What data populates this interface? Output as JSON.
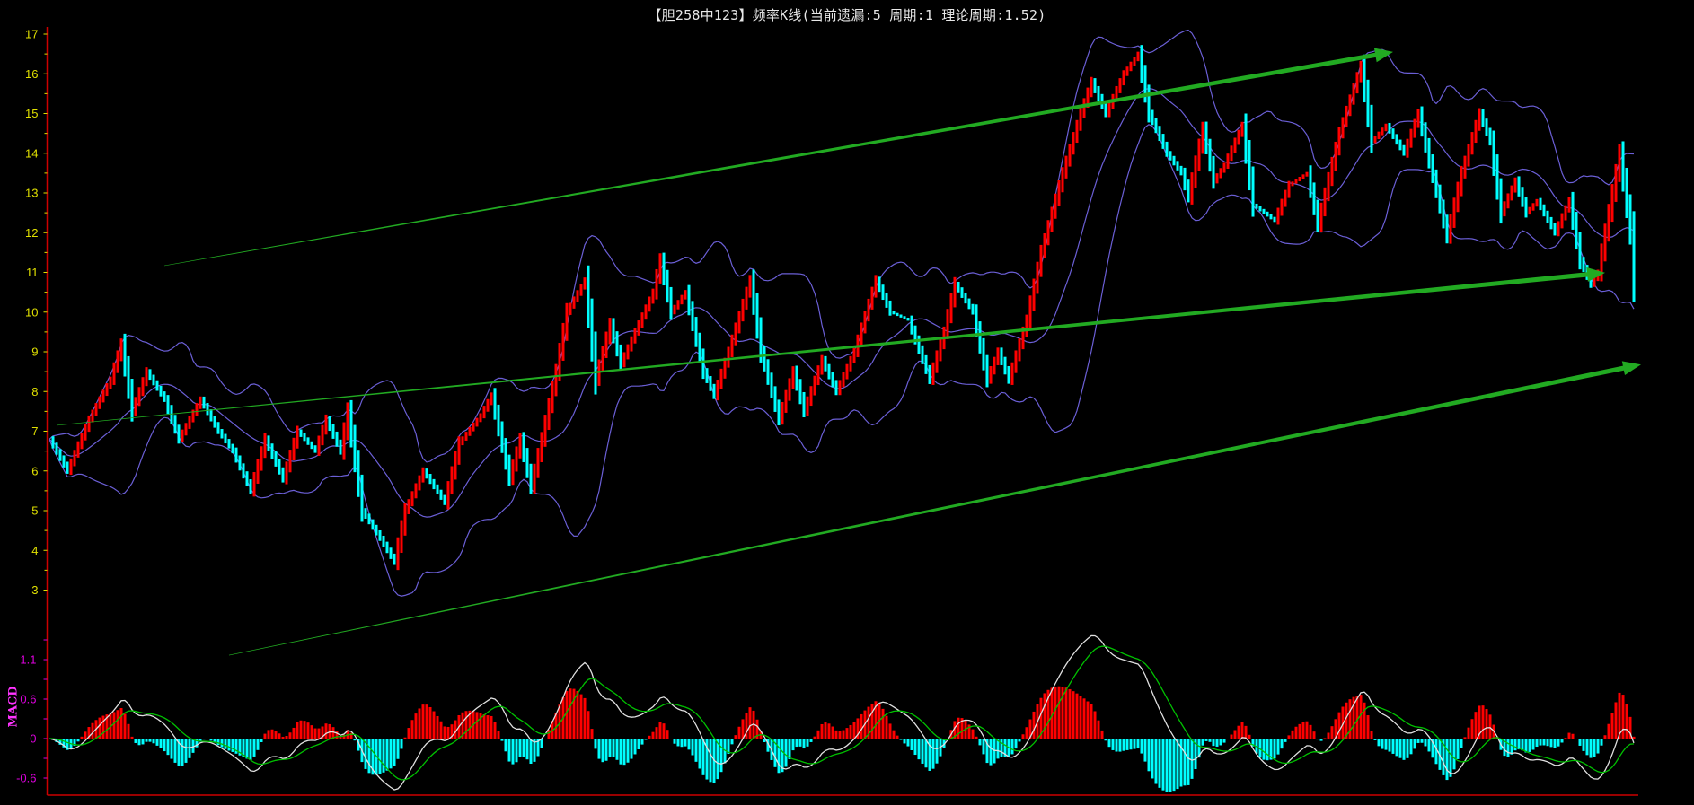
{
  "chart_data": {
    "type": "candlestick",
    "title": "【胆258中123】频率K线(当前遗漏:5 周期:1 理论周期:1.52)",
    "price_axis": {
      "ylim": [
        3,
        17
      ],
      "tick_labels": [
        "3",
        "4",
        "5",
        "6",
        "7",
        "8",
        "9",
        "10",
        "11",
        "12",
        "13",
        "14",
        "15",
        "16",
        "17"
      ]
    },
    "indicator": {
      "name": "MACD",
      "tick_labels": [
        "1.1",
        "0.6",
        "0",
        "-0.6"
      ]
    },
    "colors": {
      "up": "#ff0000",
      "down": "#00ffff",
      "bands": "#6b5fd6",
      "dif": "#e0e0e0",
      "dea": "#00c000",
      "arrow": "#22aa22",
      "axis": "#cc0000"
    },
    "bollinger": {
      "period": 20,
      "k": 2
    },
    "macd_params": {
      "fast": 12,
      "slow": 26,
      "signal": 9
    },
    "close_path": [
      [
        0,
        6.8
      ],
      [
        5,
        6.0
      ],
      [
        11,
        7.3
      ],
      [
        17,
        8.3
      ],
      [
        20,
        9.2
      ],
      [
        23,
        7.5
      ],
      [
        27,
        8.5
      ],
      [
        32,
        7.8
      ],
      [
        36,
        6.8
      ],
      [
        42,
        7.8
      ],
      [
        47,
        7.0
      ],
      [
        51,
        6.5
      ],
      [
        56,
        5.5
      ],
      [
        60,
        6.8
      ],
      [
        65,
        5.8
      ],
      [
        69,
        7.0
      ],
      [
        74,
        6.5
      ],
      [
        77,
        7.3
      ],
      [
        81,
        6.5
      ],
      [
        83,
        7.5
      ],
      [
        87,
        5.0
      ],
      [
        92,
        4.3
      ],
      [
        96,
        3.7
      ],
      [
        99,
        5.0
      ],
      [
        104,
        6.0
      ],
      [
        110,
        5.2
      ],
      [
        114,
        6.7
      ],
      [
        120,
        7.4
      ],
      [
        123,
        7.9
      ],
      [
        128,
        5.8
      ],
      [
        131,
        6.8
      ],
      [
        134,
        5.6
      ],
      [
        137,
        6.8
      ],
      [
        141,
        8.5
      ],
      [
        144,
        10.0
      ],
      [
        149,
        10.8
      ],
      [
        152,
        8.3
      ],
      [
        156,
        9.7
      ],
      [
        159,
        8.7
      ],
      [
        164,
        9.7
      ],
      [
        168,
        10.5
      ],
      [
        170,
        11.3
      ],
      [
        173,
        10.0
      ],
      [
        177,
        10.5
      ],
      [
        182,
        8.5
      ],
      [
        185,
        7.9
      ],
      [
        189,
        9.0
      ],
      [
        195,
        10.8
      ],
      [
        198,
        9.0
      ],
      [
        203,
        7.3
      ],
      [
        207,
        8.5
      ],
      [
        210,
        7.5
      ],
      [
        215,
        8.8
      ],
      [
        219,
        8.0
      ],
      [
        224,
        9.0
      ],
      [
        230,
        10.8
      ],
      [
        234,
        10.0
      ],
      [
        239,
        9.8
      ],
      [
        245,
        8.3
      ],
      [
        249,
        9.5
      ],
      [
        252,
        10.7
      ],
      [
        257,
        10.0
      ],
      [
        261,
        8.3
      ],
      [
        264,
        9.0
      ],
      [
        267,
        8.3
      ],
      [
        272,
        9.8
      ],
      [
        276,
        11.5
      ],
      [
        282,
        13.5
      ],
      [
        287,
        15.0
      ],
      [
        290,
        15.8
      ],
      [
        294,
        15.0
      ],
      [
        299,
        16.0
      ],
      [
        303,
        16.5
      ],
      [
        306,
        15.0
      ],
      [
        311,
        14.0
      ],
      [
        315,
        13.5
      ],
      [
        317,
        12.9
      ],
      [
        321,
        14.6
      ],
      [
        324,
        13.3
      ],
      [
        327,
        13.7
      ],
      [
        332,
        14.7
      ],
      [
        335,
        12.7
      ],
      [
        341,
        12.3
      ],
      [
        345,
        13.2
      ],
      [
        350,
        13.5
      ],
      [
        353,
        12.2
      ],
      [
        359,
        14.5
      ],
      [
        365,
        16.2
      ],
      [
        368,
        14.3
      ],
      [
        372,
        14.7
      ],
      [
        377,
        14.0
      ],
      [
        381,
        15.0
      ],
      [
        384,
        13.8
      ],
      [
        389,
        11.9
      ],
      [
        393,
        13.5
      ],
      [
        398,
        15.0
      ],
      [
        401,
        14.3
      ],
      [
        404,
        12.5
      ],
      [
        408,
        13.3
      ],
      [
        411,
        12.5
      ],
      [
        414,
        12.8
      ],
      [
        419,
        12.0
      ],
      [
        423,
        12.8
      ],
      [
        426,
        11.3
      ],
      [
        429,
        10.7
      ],
      [
        431,
        11.0
      ],
      [
        434,
        12.5
      ],
      [
        437,
        14.0
      ],
      [
        440,
        12.0
      ],
      [
        441,
        10.8
      ]
    ],
    "trend_arrows": [
      {
        "name": "upper-trend-arrow",
        "from": {
          "bar": 32,
          "price": 11.17
        },
        "to": {
          "bar": 374,
          "price": 16.55
        }
      },
      {
        "name": "middle-trend-arrow",
        "from": {
          "bar": 2,
          "price": 7.15
        },
        "to": {
          "bar": 433,
          "price": 10.99
        }
      },
      {
        "name": "lower-trend-arrow",
        "from": {
          "bar": 50,
          "price": 1.36
        },
        "to": {
          "bar": 443,
          "price": 8.68
        }
      }
    ]
  }
}
